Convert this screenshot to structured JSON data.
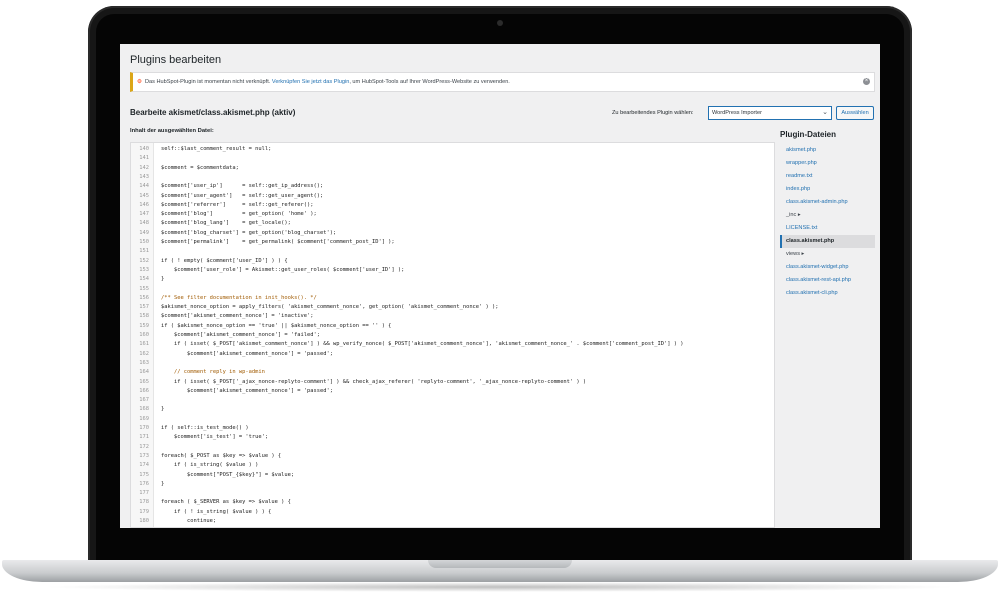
{
  "page": {
    "title": "Plugins bearbeiten",
    "notice_prefix": "Das HubSpot-Plugin ist momentan nicht verknüpft.",
    "notice_link": "Verknüpfen Sie jetzt das Plugin",
    "notice_suffix": ", um HubSpot-Tools auf Ihrer WordPress-Website zu verwenden.",
    "notice_icon": "hubspot-icon",
    "dismiss_icon": "dismiss-icon"
  },
  "editor_header": {
    "title": "Bearbeite akismet/class.akismet.php (aktiv)",
    "select_label": "Zu bearbeitendes Plugin wählen:",
    "select_value": "WordPress Importer",
    "choose_button": "Auswählen",
    "content_label": "Inhalt der ausgewählten Datei:"
  },
  "code_lines": [
    {
      "n": "140",
      "t": "self::$last_comment_result = null;"
    },
    {
      "n": "141",
      "t": ""
    },
    {
      "n": "142",
      "t": "$comment = $commentdata;"
    },
    {
      "n": "143",
      "t": ""
    },
    {
      "n": "144",
      "t": "$comment['user_ip']      = self::get_ip_address();"
    },
    {
      "n": "145",
      "t": "$comment['user_agent']   = self::get_user_agent();"
    },
    {
      "n": "146",
      "t": "$comment['referrer']     = self::get_referer();"
    },
    {
      "n": "147",
      "t": "$comment['blog']         = get_option( 'home' );"
    },
    {
      "n": "148",
      "t": "$comment['blog_lang']    = get_locale();"
    },
    {
      "n": "149",
      "t": "$comment['blog_charset'] = get_option('blog_charset');"
    },
    {
      "n": "150",
      "t": "$comment['permalink']    = get_permalink( $comment['comment_post_ID'] );"
    },
    {
      "n": "151",
      "t": ""
    },
    {
      "n": "152",
      "t": "if ( ! empty( $comment['user_ID'] ) ) {"
    },
    {
      "n": "153",
      "t": "    $comment['user_role'] = Akismet::get_user_roles( $comment['user_ID'] );"
    },
    {
      "n": "154",
      "t": "}"
    },
    {
      "n": "155",
      "t": ""
    },
    {
      "n": "156",
      "t": "/** See filter documentation in init_hooks(). */"
    },
    {
      "n": "157",
      "t": "$akismet_nonce_option = apply_filters( 'akismet_comment_nonce', get_option( 'akismet_comment_nonce' ) );"
    },
    {
      "n": "158",
      "t": "$comment['akismet_comment_nonce'] = 'inactive';"
    },
    {
      "n": "159",
      "t": "if ( $akismet_nonce_option == 'true' || $akismet_nonce_option == '' ) {"
    },
    {
      "n": "160",
      "t": "    $comment['akismet_comment_nonce'] = 'failed';"
    },
    {
      "n": "161",
      "t": "    if ( isset( $_POST['akismet_comment_nonce'] ) && wp_verify_nonce( $_POST['akismet_comment_nonce'], 'akismet_comment_nonce_' . $comment['comment_post_ID'] ) )"
    },
    {
      "n": "162",
      "t": "        $comment['akismet_comment_nonce'] = 'passed';"
    },
    {
      "n": "163",
      "t": ""
    },
    {
      "n": "164",
      "t": "    // comment reply in wp-admin"
    },
    {
      "n": "165",
      "t": "    if ( isset( $_POST['_ajax_nonce-replyto-comment'] ) && check_ajax_referer( 'replyto-comment', '_ajax_nonce-replyto-comment' ) )"
    },
    {
      "n": "166",
      "t": "        $comment['akismet_comment_nonce'] = 'passed';"
    },
    {
      "n": "167",
      "t": ""
    },
    {
      "n": "168",
      "t": "}"
    },
    {
      "n": "169",
      "t": ""
    },
    {
      "n": "170",
      "t": "if ( self::is_test_mode() )"
    },
    {
      "n": "171",
      "t": "    $comment['is_test'] = 'true';"
    },
    {
      "n": "172",
      "t": ""
    },
    {
      "n": "173",
      "t": "foreach( $_POST as $key => $value ) {"
    },
    {
      "n": "174",
      "t": "    if ( is_string( $value ) )"
    },
    {
      "n": "175",
      "t": "        $comment[\"POST_{$key}\"] = $value;"
    },
    {
      "n": "176",
      "t": "}"
    },
    {
      "n": "177",
      "t": ""
    },
    {
      "n": "178",
      "t": "foreach ( $_SERVER as $key => $value ) {"
    },
    {
      "n": "179",
      "t": "    if ( ! is_string( $value ) ) {"
    },
    {
      "n": "180",
      "t": "        continue;"
    }
  ],
  "files_panel": {
    "title": "Plugin-Dateien",
    "items": [
      {
        "label": "akismet.php",
        "kind": "file"
      },
      {
        "label": "wrapper.php",
        "kind": "file"
      },
      {
        "label": "readme.txt",
        "kind": "file"
      },
      {
        "label": "index.php",
        "kind": "file"
      },
      {
        "label": "class.akismet-admin.php",
        "kind": "file"
      },
      {
        "label": "_inc ▸",
        "kind": "folder"
      },
      {
        "label": "LICENSE.txt",
        "kind": "file"
      },
      {
        "label": "class.akismet.php",
        "kind": "active"
      },
      {
        "label": "views ▸",
        "kind": "folder"
      },
      {
        "label": "class.akismet-widget.php",
        "kind": "file"
      },
      {
        "label": "class.akismet-rest-api.php",
        "kind": "file"
      },
      {
        "label": "class.akismet-cli.php",
        "kind": "file"
      }
    ]
  },
  "colors": {
    "link": "#2271b1",
    "notice_border": "#dba617",
    "hubspot": "#ff7a59"
  }
}
